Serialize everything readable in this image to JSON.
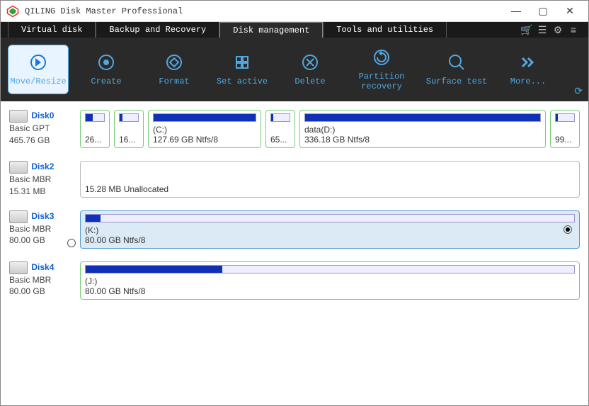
{
  "window": {
    "title": "QILING Disk Master Professional"
  },
  "tabs": {
    "virtual": "Virtual disk",
    "backup": "Backup and Recovery",
    "diskmgmt": "Disk management",
    "tools": "Tools and utilities"
  },
  "toolbar": {
    "move_resize": "Move/Resize",
    "create": "Create",
    "format": "Format",
    "set_active": "Set active",
    "delete": "Delete",
    "partition_recovery": "Partition\nrecovery",
    "surface_test": "Surface test",
    "more": "More..."
  },
  "disks": {
    "d0": {
      "name": "Disk0",
      "type": "Basic GPT",
      "size": "465.76 GB",
      "parts": {
        "p0": {
          "label": "",
          "detail": "26...",
          "fill": 40
        },
        "p1": {
          "label": "",
          "detail": "16...",
          "fill": 15
        },
        "p2": {
          "label": "(C:)",
          "detail": "127.69 GB Ntfs/8",
          "fill": 100
        },
        "p3": {
          "label": "",
          "detail": "65...",
          "fill": 10
        },
        "p4": {
          "label": "data(D:)",
          "detail": "336.18 GB Ntfs/8",
          "fill": 100
        },
        "p5": {
          "label": "",
          "detail": "99...",
          "fill": 10
        }
      }
    },
    "d2": {
      "name": "Disk2",
      "type": "Basic MBR",
      "size": "15.31 MB",
      "parts": {
        "p0": {
          "label": "",
          "detail": "15.28 MB Unallocated",
          "fill": 0
        }
      }
    },
    "d3": {
      "name": "Disk3",
      "type": "Basic MBR",
      "size": "80.00 GB",
      "parts": {
        "p0": {
          "label": "(K:)",
          "detail": "80.00 GB Ntfs/8",
          "fill": 3
        }
      }
    },
    "d4": {
      "name": "Disk4",
      "type": "Basic MBR",
      "size": "80.00 GB",
      "parts": {
        "p0": {
          "label": "(J:)",
          "detail": "80.00 GB Ntfs/8",
          "fill": 28
        }
      }
    }
  }
}
